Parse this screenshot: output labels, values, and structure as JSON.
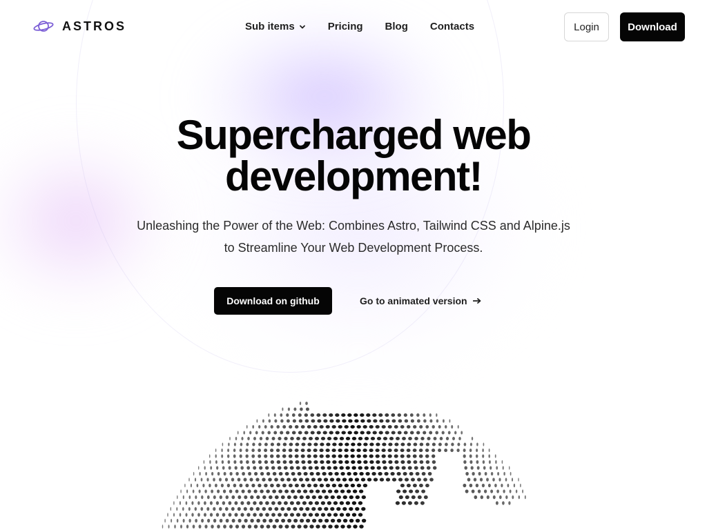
{
  "brand": {
    "name": "ASTROS",
    "logo_icon": "planet-icon",
    "accent_color": "#7c5fd6"
  },
  "nav": {
    "items": [
      {
        "label": "Sub items",
        "has_dropdown": true
      },
      {
        "label": "Pricing"
      },
      {
        "label": "Blog"
      },
      {
        "label": "Contacts"
      }
    ]
  },
  "header_actions": {
    "login_label": "Login",
    "download_label": "Download"
  },
  "hero": {
    "title_line1": "Supercharged web",
    "title_line2": "development!",
    "subtitle_line1": "Unleashing the Power of the Web: Combines Astro, Tailwind CSS and Alpine.js",
    "subtitle_line2": "to Streamline Your Web Development Process.",
    "primary_cta": "Download on github",
    "secondary_cta": "Go to animated version",
    "secondary_cta_icon": "arrow-right-icon"
  },
  "visual": {
    "globe_icon": "dotted-globe",
    "globe_color": "#111111"
  }
}
